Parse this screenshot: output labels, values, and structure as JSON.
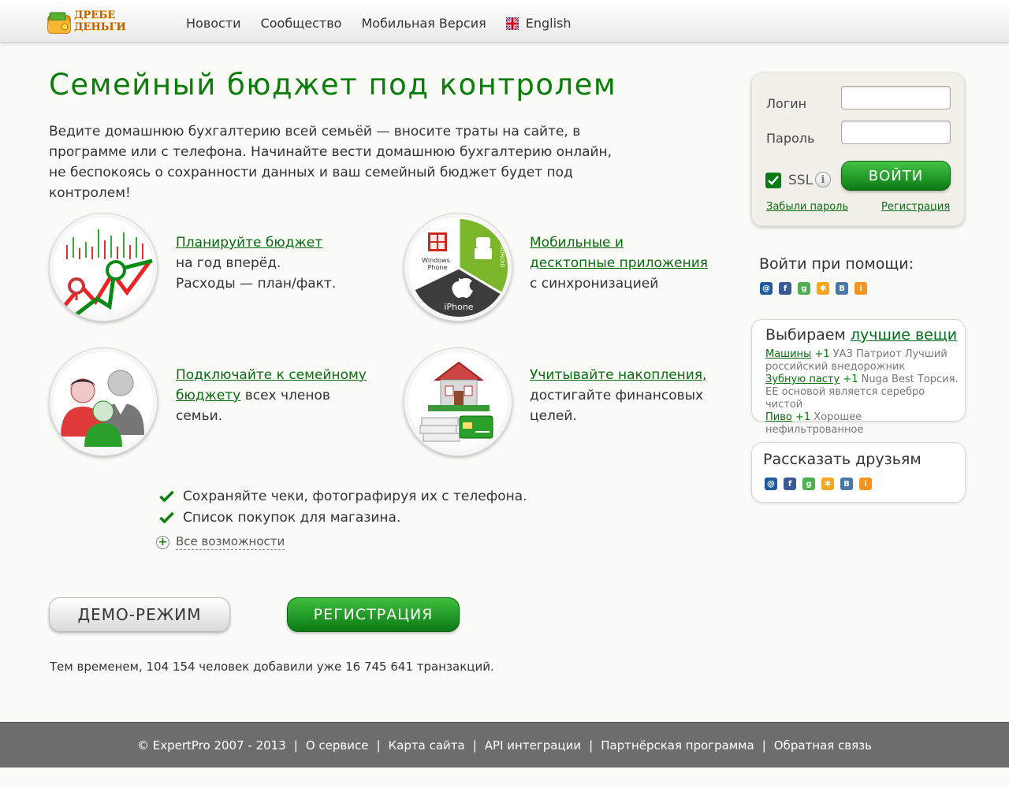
{
  "header": {
    "logo_line1": "ДРЕБЕ",
    "logo_line2": "ДЕНЬГИ",
    "nav": [
      "Новости",
      "Сообщество",
      "Мобильная Версия"
    ],
    "lang_label": "English"
  },
  "hero": {
    "title": "Семейный бюджет под контролем",
    "description": "Ведите домашнюю бухгалтерию всей семьёй — вносите траты на сайте, в программе или с телефона. Начинайте вести домашнюю бухгалтерию онлайн, не беспокоясь о сохранности данных и ваш семейный бюджет будет под контролем!"
  },
  "features": {
    "budget": {
      "link": "Планируйте бюджет",
      "line1": "на год вперёд.",
      "line2": "Расходы — план/факт."
    },
    "apps": {
      "link": "Мобильные и десктопные приложения",
      "line1": "с синхронизацией",
      "windows_label": "Windows Phone",
      "android_label": "ANDROID",
      "iphone_label": "iPhone"
    },
    "family": {
      "link": "Подключайте к семейному бюджету",
      "rest": " всех членов семьи."
    },
    "savings": {
      "link": "Учитывайте накопления,",
      "rest": "достигайте финансовых целей."
    }
  },
  "checks": [
    "Сохраняйте чеки, фотографируя их с телефона.",
    "Список покупок для магазина."
  ],
  "all_features": "Все возможности",
  "buttons": {
    "demo": "ДЕМО-РЕЖИМ",
    "register": "РЕГИСТРАЦИЯ"
  },
  "stats": "Тем временем, 104 154  человек добавили уже 16 745 641 транзакций.",
  "login": {
    "login_label": "Логин",
    "password_label": "Пароль",
    "ssl_label": "SSL",
    "submit": "ВОЙТИ",
    "forgot": "Забыли пароль",
    "register": "Регистрация"
  },
  "social_login_title": "Войти при помощи:",
  "best": {
    "title_prefix": "Выбираем ",
    "title_link": "лучшие вещи",
    "items": [
      {
        "link": "Машины",
        "plus": "+1",
        "text": " УАЗ Патриот Лучший российский внедорожник"
      },
      {
        "link": "Зубную пасту",
        "plus": "+1",
        "text": " Nuga Best Торсия. ЕЕ основой является серебро чистой"
      },
      {
        "link": "Пиво",
        "plus": "+1",
        "text": " Хорошее нефильтрованное"
      }
    ]
  },
  "share_title": "Рассказать друзьям",
  "social_icons": [
    {
      "name": "mailru-icon",
      "glyph": "@",
      "color": "#1d5a9e"
    },
    {
      "name": "facebook-icon",
      "glyph": "f",
      "color": "#3b5998"
    },
    {
      "name": "google-icon",
      "glyph": "g",
      "color": "#4caf50"
    },
    {
      "name": "yandex-icon",
      "glyph": "✱",
      "color": "#f5a623"
    },
    {
      "name": "vkontakte-icon",
      "glyph": "B",
      "color": "#4a76a8"
    },
    {
      "name": "odnoklassniki-icon",
      "glyph": "i",
      "color": "#f7931e"
    }
  ],
  "footer": {
    "copyright": "© ExpertPro 2007 - 2013",
    "links": [
      "О сервисе",
      "Карта сайта",
      "API интеграции",
      "Партнёрская программа",
      "Обратная связь"
    ]
  }
}
